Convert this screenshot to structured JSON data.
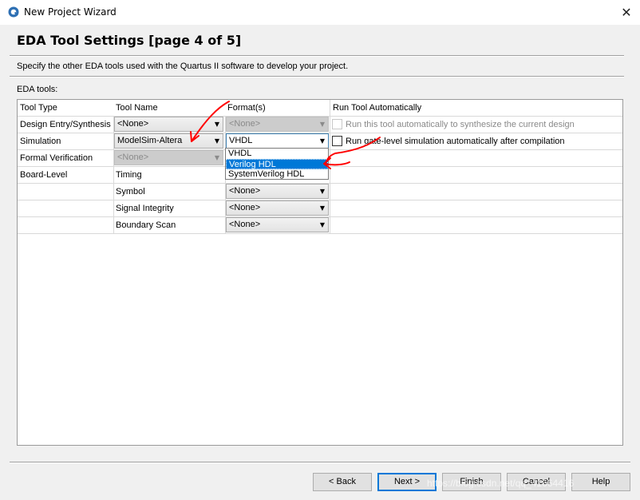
{
  "window": {
    "title": "New Project Wizard",
    "close_glyph": "✕"
  },
  "page": {
    "title": "EDA Tool Settings [page 4 of 5]",
    "description": "Specify the other EDA tools used with the Quartus II software to develop your project.",
    "eda_label": "EDA tools:"
  },
  "table": {
    "headers": [
      "Tool Type",
      "Tool Name",
      "Format(s)",
      "Run Tool Automatically"
    ],
    "rows": [
      {
        "type": "Design Entry/Synthesis",
        "tool": "<None>",
        "format": "<None>",
        "run": "Run this tool automatically to synthesize the current design"
      },
      {
        "type": "Simulation",
        "tool": "ModelSim-Altera",
        "format": "VHDL",
        "run": "Run gate-level simulation automatically after compilation"
      },
      {
        "type": "Formal Verification",
        "tool": "<None>",
        "format": "",
        "run": ""
      },
      {
        "type": "Board-Level",
        "tool": "Timing",
        "format": "",
        "run": ""
      },
      {
        "type": "",
        "tool": "Symbol",
        "format": "<None>",
        "run": ""
      },
      {
        "type": "",
        "tool": "Signal Integrity",
        "format": "<None>",
        "run": ""
      },
      {
        "type": "",
        "tool": "Boundary Scan",
        "format": "<None>",
        "run": ""
      }
    ]
  },
  "format_dropdown": {
    "options": [
      "VHDL",
      "Verilog HDL",
      "SystemVerilog HDL"
    ],
    "selected": "Verilog HDL"
  },
  "buttons": {
    "back": "< Back",
    "next": "Next >",
    "finish": "Finish",
    "cancel": "Cancel",
    "help": "Help"
  },
  "watermark": "https://blog.csdn.net/qq_41664416",
  "colors": {
    "selection": "#0078d7",
    "annotation": "#ff0000",
    "disabled_combo": "#cccccc"
  },
  "icons": {
    "app": "quartus-logo-icon",
    "dropdown": "chevron-down-icon"
  }
}
